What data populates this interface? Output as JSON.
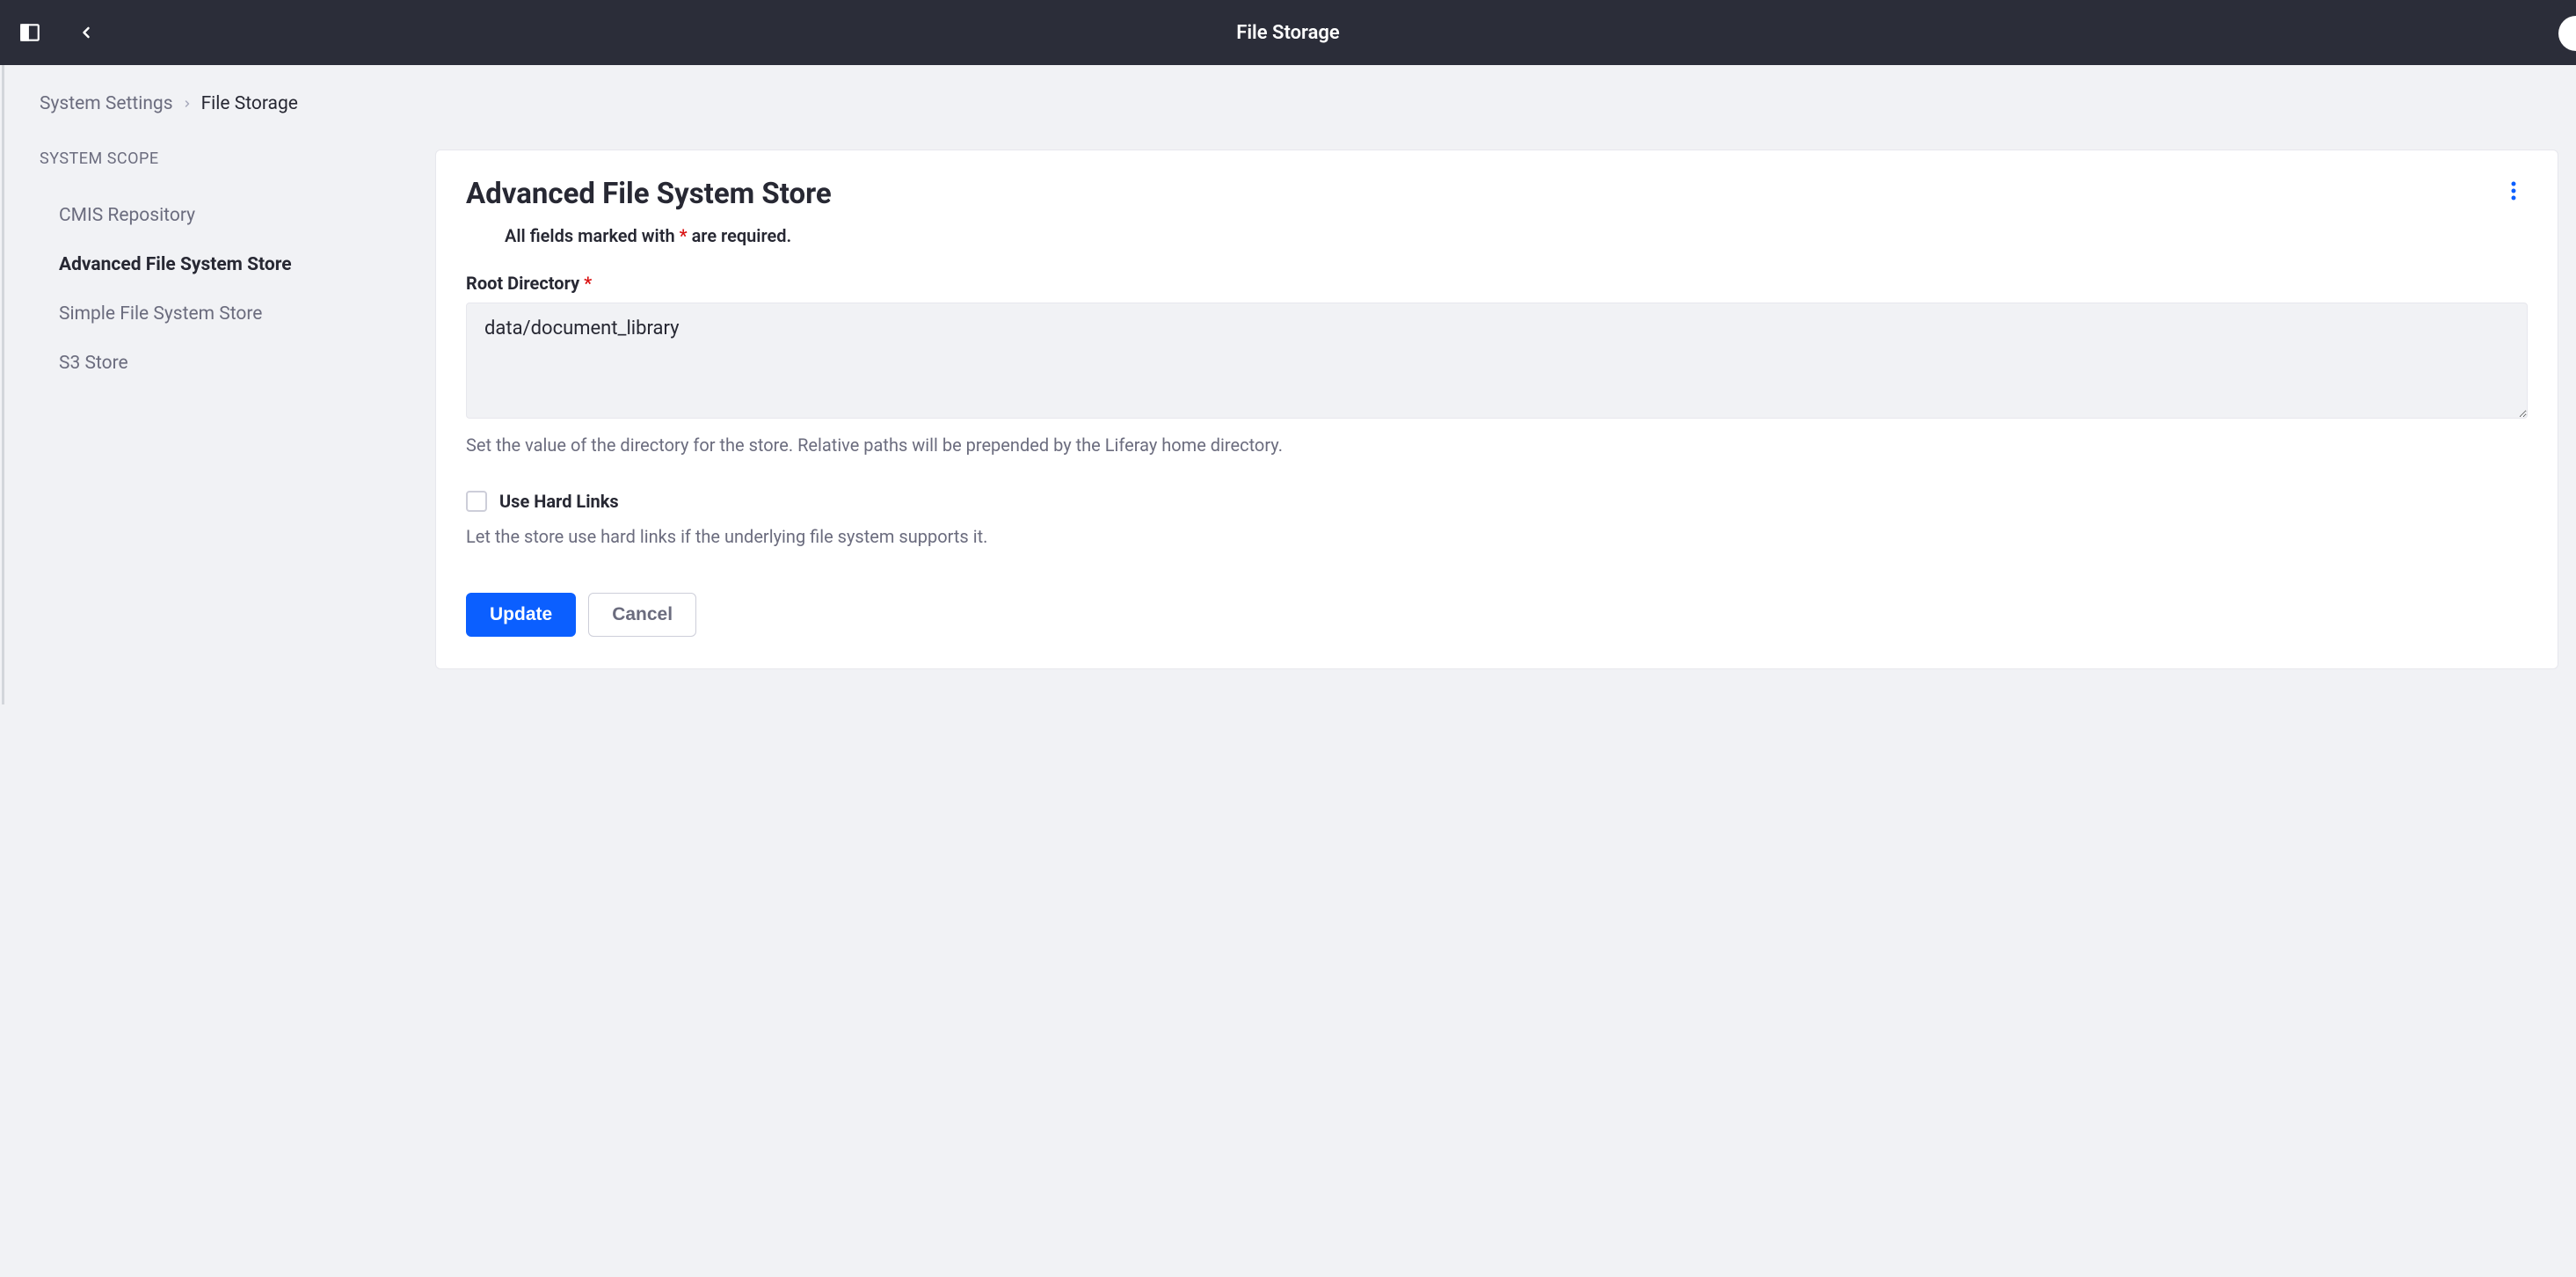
{
  "topbar": {
    "title": "File Storage"
  },
  "breadcrumb": {
    "parent": "System Settings",
    "current": "File Storage"
  },
  "sidebar": {
    "scope_label": "SYSTEM SCOPE",
    "items": [
      {
        "label": "CMIS Repository"
      },
      {
        "label": "Advanced File System Store"
      },
      {
        "label": "Simple File System Store"
      },
      {
        "label": "S3 Store"
      }
    ]
  },
  "panel": {
    "title": "Advanced File System Store",
    "required_prefix": "All fields marked with ",
    "required_suffix": " are required.",
    "root_dir": {
      "label": "Root Directory ",
      "value": "data/document_library",
      "help": "Set the value of the directory for the store. Relative paths will be prepended by the Liferay home directory."
    },
    "hard_links": {
      "label": "Use Hard Links",
      "help": "Let the store use hard links if the underlying file system supports it."
    },
    "buttons": {
      "update": "Update",
      "cancel": "Cancel"
    }
  }
}
